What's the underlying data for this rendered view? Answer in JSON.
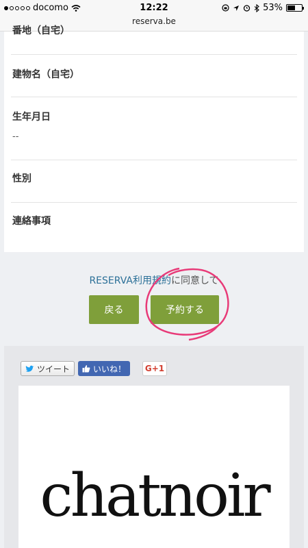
{
  "status_bar": {
    "carrier": "docomo",
    "time": "12:22",
    "battery": "53%",
    "battery_level": 0.53,
    "url": "reserva.be"
  },
  "form": {
    "fields": [
      {
        "label": "番地（自宅）",
        "value": ""
      },
      {
        "label": "建物名（自宅）",
        "value": ""
      },
      {
        "label": "生年月日",
        "value": "--"
      },
      {
        "label": "性別",
        "value": ""
      },
      {
        "label": "連絡事項",
        "value": ""
      }
    ]
  },
  "agreement": {
    "link_text": "RESERVA利用規約",
    "suffix": "に同意して"
  },
  "buttons": {
    "back": "戻る",
    "reserve": "予約する"
  },
  "share": {
    "tweet": "ツイート",
    "like": "いいね！",
    "gplus": "G+1"
  },
  "logo_text": "chatnoir",
  "colors": {
    "button": "#7f9f3a",
    "link": "#2a6f97",
    "annotation": "#e83a78"
  }
}
